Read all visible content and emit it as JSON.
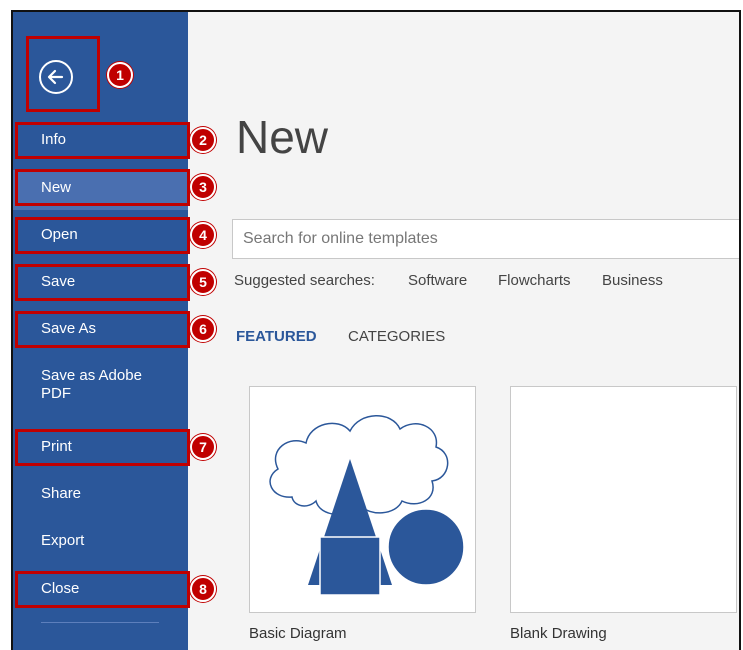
{
  "sidebar": {
    "back_icon": "back-arrow-icon",
    "items": [
      {
        "label": "Info"
      },
      {
        "label": "New"
      },
      {
        "label": "Open"
      },
      {
        "label": "Save"
      },
      {
        "label": "Save As"
      },
      {
        "label": "Save as Adobe PDF"
      },
      {
        "label": "Print"
      },
      {
        "label": "Share"
      },
      {
        "label": "Export"
      },
      {
        "label": "Close"
      }
    ],
    "active": "New"
  },
  "callouts": [
    "1",
    "2",
    "3",
    "4",
    "5",
    "6",
    "7",
    "8"
  ],
  "main": {
    "title": "New",
    "search_placeholder": "Search for online templates",
    "suggested_label": "Suggested searches:",
    "suggested": [
      "Software",
      "Flowcharts",
      "Business"
    ],
    "tabs": [
      "FEATURED",
      "CATEGORIES"
    ],
    "templates": [
      {
        "label": "Basic Diagram"
      },
      {
        "label": "Blank Drawing"
      }
    ]
  },
  "colors": {
    "sidebar": "#2b579a",
    "active_item": "#4a6fb0",
    "callout": "#c00000",
    "accent": "#2b579a"
  }
}
